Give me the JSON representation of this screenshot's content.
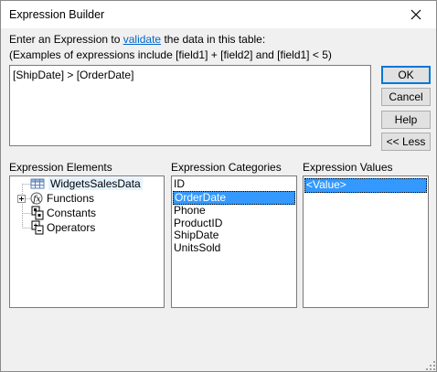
{
  "window": {
    "title": "Expression Builder"
  },
  "intro": {
    "line1_prefix": "Enter an Expression to ",
    "line1_link": "validate",
    "line1_suffix": " the data in this table:",
    "line2": "(Examples of expressions include [field1] + [field2] and [field1] < 5)"
  },
  "expression": {
    "value": "[ShipDate] > [OrderDate]"
  },
  "buttons": {
    "ok": "OK",
    "cancel": "Cancel",
    "help": "Help",
    "less": "<< Less"
  },
  "elements": {
    "label": "Expression Elements",
    "items": [
      {
        "label": "WidgetsSalesData",
        "icon": "table-icon"
      },
      {
        "label": "Functions",
        "icon": "function-icon"
      },
      {
        "label": "Constants",
        "icon": "constants-icon"
      },
      {
        "label": "Operators",
        "icon": "operators-icon"
      }
    ]
  },
  "categories": {
    "label": "Expression Categories",
    "items": [
      "ID",
      "OrderDate",
      "Phone",
      "ProductID",
      "ShipDate",
      "UnitsSold"
    ],
    "selected": "OrderDate"
  },
  "values": {
    "label": "Expression Values",
    "items": [
      "<Value>"
    ],
    "selected": "<Value>"
  }
}
